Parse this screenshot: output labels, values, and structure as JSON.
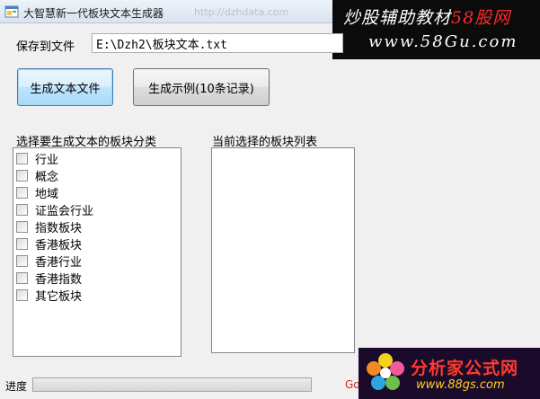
{
  "window": {
    "title": "大智慧新一代板块文本生成器",
    "title_ghost": "http://dzhdata.com"
  },
  "banner": {
    "line1_white": "炒股辅助教材",
    "line1_red": "58股网",
    "line2": "www.58Gu.com"
  },
  "form": {
    "save_label": "保存到文件",
    "path_value": "E:\\Dzh2\\板块文本.txt",
    "generate_button": "生成文本文件",
    "sample_button": "生成示例(10条记录)"
  },
  "left_panel": {
    "label": "选择要生成文本的板块分类",
    "items": [
      "行业",
      "概念",
      "地域",
      "证监会行业",
      "指数板块",
      "香港板块",
      "香港行业",
      "香港指数",
      "其它板块"
    ]
  },
  "right_panel": {
    "label": "当前选择的板块列表"
  },
  "status": {
    "progress_label": "进度",
    "progress": 0,
    "go_text": "Go"
  },
  "logo2": {
    "name": "分析家公式网",
    "url": "www.88gs.com"
  },
  "colors": {
    "banner_red": "#ff2a2a",
    "logo2_red": "#ff3b2f",
    "logo2_url": "#ffd21f"
  }
}
